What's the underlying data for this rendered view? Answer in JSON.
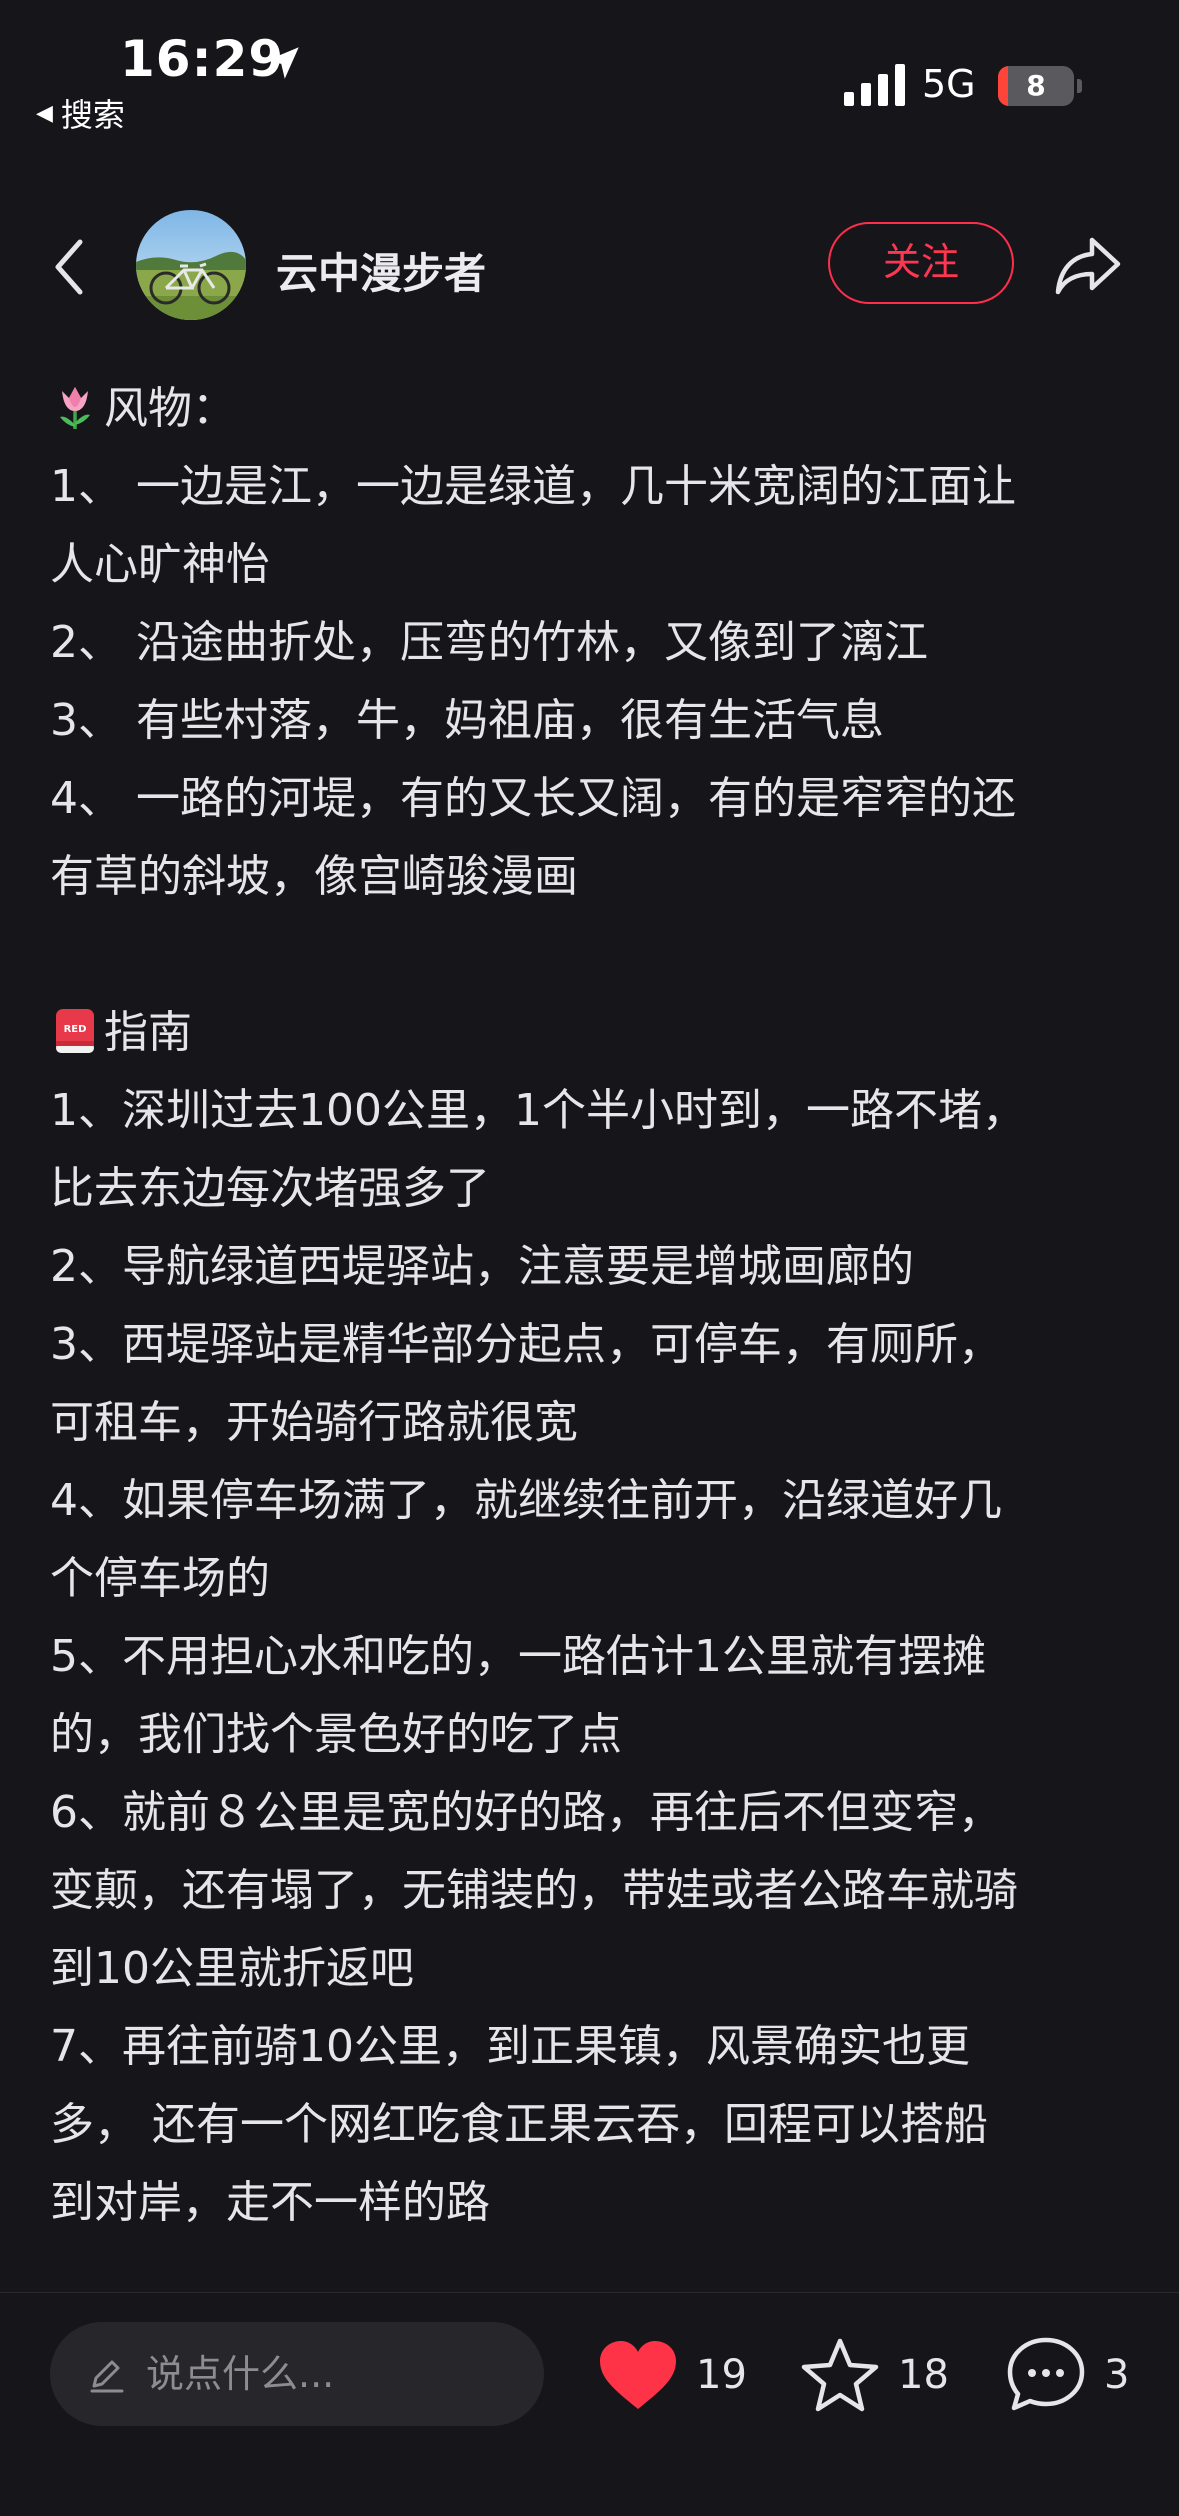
{
  "status_bar": {
    "time": "16:29",
    "back_app": "搜索",
    "network": "5G",
    "battery_level": "8"
  },
  "header": {
    "username": "云中漫步者",
    "follow_label": "关注"
  },
  "content": {
    "lines": [
      "风物：",
      "1、 一边是江，一边是绿道，几十米宽阔的江面让",
      "人心旷神怡",
      "2、 沿途曲折处，压弯的竹林，又像到了漓江",
      "3、 有些村落，牛，妈祖庙，很有生活气息",
      "4、 一路的河堤，有的又长又阔，有的是窄窄的还",
      "有草的斜坡，像宫崎骏漫画",
      "",
      "指南",
      "1、深圳过去100公里，1个半小时到，一路不堵，",
      "比去东边每次堵强多了",
      "2、导航绿道西堤驿站，注意要是增城画廊的",
      "3、西堤驿站是精华部分起点，可停车，有厕所，",
      "可租车，开始骑行路就很宽",
      "4、如果停车场满了，就继续往前开，沿绿道好几",
      "个停车场的",
      "5、不用担心水和吃的，一路估计1公里就有摆摊",
      "的，我们找个景色好的吃了点",
      "6、就前８公里是宽的好的路，再往后不但变窄，",
      "变颠，还有塌了，无铺装的，带娃或者公路车就骑",
      "到10公里就折返吧",
      "7、再往前骑10公里，到正果镇，风景确实也更",
      "多， 还有一个网红吃食正果云吞，回程可以搭船",
      "到对岸，走不一样的路"
    ]
  },
  "bottom_bar": {
    "comment_placeholder": "说点什么...",
    "like_count": "19",
    "collect_count": "18",
    "comment_count": "3"
  },
  "colors": {
    "background": "#16161a",
    "accent_red": "#ff2e4d",
    "text": "#e6e6e9"
  },
  "icons": [
    "location-arrow-icon",
    "signal-bars-icon",
    "back-chevron-icon",
    "share-icon",
    "tulip-emoji-icon",
    "red-book-icon",
    "pen-icon",
    "heart-icon",
    "star-icon",
    "chat-bubble-icon"
  ]
}
